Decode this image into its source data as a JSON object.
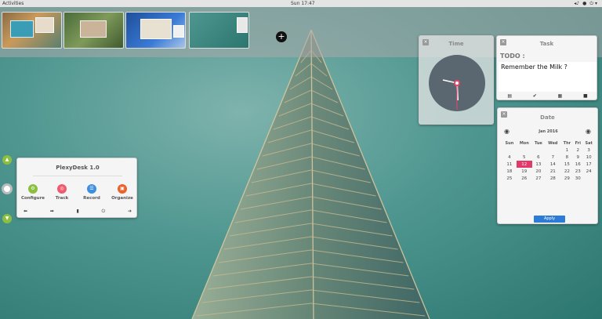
{
  "topbar": {
    "activities": "Activities",
    "clock": "Sun 17:47",
    "tray": [
      "◂♪",
      "●",
      "⏻ ▾"
    ]
  },
  "workspace": {
    "add": "+"
  },
  "time_widget": {
    "title": "Time"
  },
  "task_widget": {
    "title": "Task",
    "todo_label": "TODO :",
    "memo": "Remember the Milk ?",
    "icons": [
      "▤",
      "✔",
      "▦",
      "■"
    ]
  },
  "date_widget": {
    "title": "Date",
    "month": "Jan 2016",
    "prev": "◉",
    "next": "◉",
    "weekdays": [
      "Sun",
      "Mon",
      "Tue",
      "Wed",
      "Thr",
      "Fri",
      "Sat"
    ],
    "weeks": [
      [
        "",
        "",
        "",
        "",
        "1",
        "2",
        "3"
      ],
      [
        "4",
        "5",
        "6",
        "7",
        "8",
        "9",
        "10"
      ],
      [
        "11",
        "12",
        "13",
        "14",
        "15",
        "16",
        "17"
      ],
      [
        "18",
        "19",
        "20",
        "21",
        "22",
        "23",
        "24"
      ],
      [
        "25",
        "26",
        "27",
        "28",
        "29",
        "30",
        ""
      ]
    ],
    "selected": "12",
    "apply": "Apply"
  },
  "plexy": {
    "title": "PlexyDesk 1.0",
    "apps": [
      {
        "label": "Configure",
        "color": "#8cbf3f"
      },
      {
        "label": "Track",
        "color": "#ef5a6e"
      },
      {
        "label": "Record",
        "color": "#3d8fe0"
      },
      {
        "label": "Organize",
        "color": "#e8622a"
      }
    ],
    "bar": [
      "⬅",
      "➡",
      "▮",
      "⏻",
      "➔"
    ]
  },
  "side_buttons": [
    "▲",
    "",
    "▼"
  ]
}
